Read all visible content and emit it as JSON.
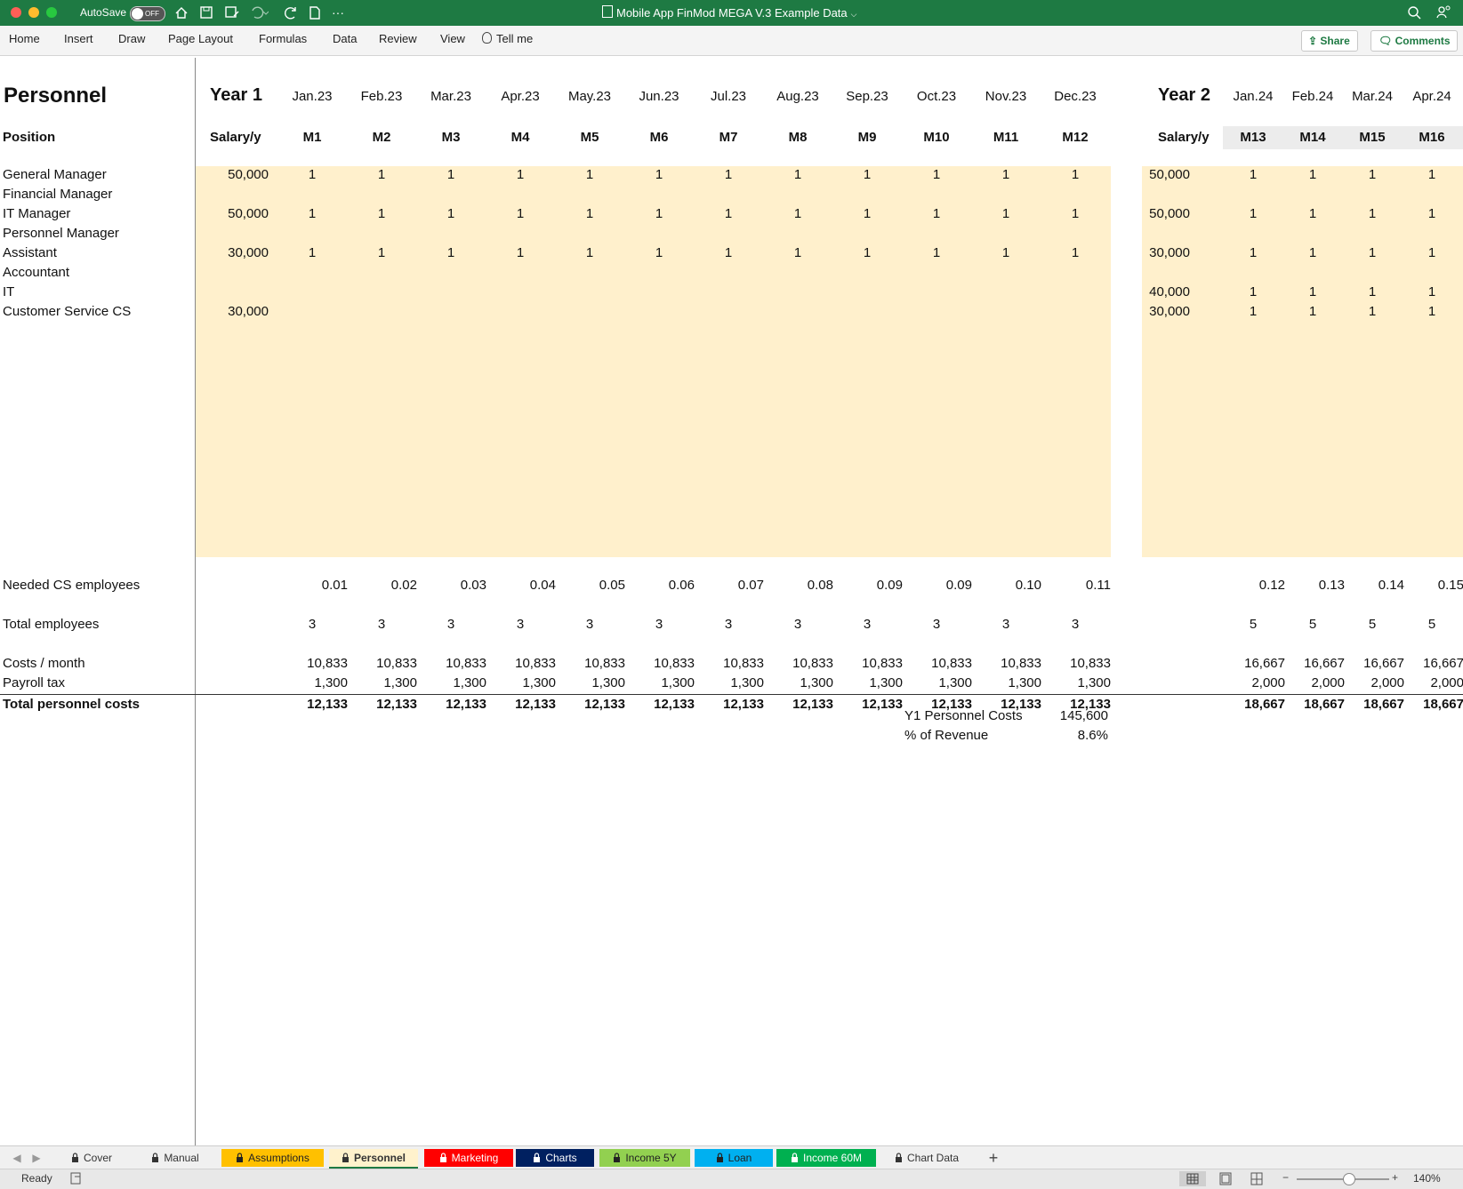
{
  "window": {
    "autosave_label": "AutoSave",
    "autosave_state": "OFF",
    "title": "Mobile App FinMod MEGA V.3 Example Data",
    "titlebar_color": "#1e7a43"
  },
  "ribbon": {
    "tabs": [
      "Home",
      "Insert",
      "Draw",
      "Page Layout",
      "Formulas",
      "Data",
      "Review",
      "View",
      "Tell me"
    ],
    "share_label": "Share",
    "comments_label": "Comments"
  },
  "sheet": {
    "title": "Personnel",
    "position_header": "Position",
    "year1": {
      "label": "Year 1",
      "salary_header": "Salary/y",
      "months": [
        "Jan.23",
        "Feb.23",
        "Mar.23",
        "Apr.23",
        "May.23",
        "Jun.23",
        "Jul.23",
        "Aug.23",
        "Sep.23",
        "Oct.23",
        "Nov.23",
        "Dec.23"
      ],
      "mcodes": [
        "M1",
        "M2",
        "M3",
        "M4",
        "M5",
        "M6",
        "M7",
        "M8",
        "M9",
        "M10",
        "M11",
        "M12"
      ]
    },
    "year2": {
      "label": "Year 2",
      "salary_header": "Salary/y",
      "months": [
        "Jan.24",
        "Feb.24",
        "Mar.24",
        "Apr.24"
      ],
      "mcodes": [
        "M13",
        "M14",
        "M15",
        "M16"
      ]
    },
    "positions": [
      {
        "name": "General Manager",
        "y1_salary": "50,000",
        "y1": [
          "1",
          "1",
          "1",
          "1",
          "1",
          "1",
          "1",
          "1",
          "1",
          "1",
          "1",
          "1"
        ],
        "y2_salary": "50,000",
        "y2": [
          "1",
          "1",
          "1",
          "1"
        ]
      },
      {
        "name": "Financial Manager",
        "y1_salary": "",
        "y1": [
          "",
          "",
          "",
          "",
          "",
          "",
          "",
          "",
          "",
          "",
          "",
          ""
        ],
        "y2_salary": "",
        "y2": [
          "",
          "",
          "",
          ""
        ]
      },
      {
        "name": "IT Manager",
        "y1_salary": "50,000",
        "y1": [
          "1",
          "1",
          "1",
          "1",
          "1",
          "1",
          "1",
          "1",
          "1",
          "1",
          "1",
          "1"
        ],
        "y2_salary": "50,000",
        "y2": [
          "1",
          "1",
          "1",
          "1"
        ]
      },
      {
        "name": "Personnel Manager",
        "y1_salary": "",
        "y1": [
          "",
          "",
          "",
          "",
          "",
          "",
          "",
          "",
          "",
          "",
          "",
          ""
        ],
        "y2_salary": "",
        "y2": [
          "",
          "",
          "",
          ""
        ]
      },
      {
        "name": "Assistant",
        "y1_salary": "30,000",
        "y1": [
          "1",
          "1",
          "1",
          "1",
          "1",
          "1",
          "1",
          "1",
          "1",
          "1",
          "1",
          "1"
        ],
        "y2_salary": "30,000",
        "y2": [
          "1",
          "1",
          "1",
          "1"
        ]
      },
      {
        "name": "Accountant",
        "y1_salary": "",
        "y1": [
          "",
          "",
          "",
          "",
          "",
          "",
          "",
          "",
          "",
          "",
          "",
          ""
        ],
        "y2_salary": "",
        "y2": [
          "",
          "",
          "",
          ""
        ]
      },
      {
        "name": "IT",
        "y1_salary": "",
        "y1": [
          "",
          "",
          "",
          "",
          "",
          "",
          "",
          "",
          "",
          "",
          "",
          ""
        ],
        "y2_salary": "40,000",
        "y2": [
          "1",
          "1",
          "1",
          "1"
        ]
      },
      {
        "name": "Customer Service CS",
        "y1_salary": "30,000",
        "y1": [
          "",
          "",
          "",
          "",
          "",
          "",
          "",
          "",
          "",
          "",
          "",
          ""
        ],
        "y2_salary": "30,000",
        "y2": [
          "1",
          "1",
          "1",
          "1"
        ]
      }
    ],
    "summary_rows": [
      {
        "label": "Needed CS employees",
        "y1": [
          "0.01",
          "0.02",
          "0.03",
          "0.04",
          "0.05",
          "0.06",
          "0.07",
          "0.08",
          "0.09",
          "0.09",
          "0.10",
          "0.11"
        ],
        "y2": [
          "0.12",
          "0.13",
          "0.14",
          "0.15"
        ]
      },
      {
        "label": "Total employees",
        "y1": [
          "3",
          "3",
          "3",
          "3",
          "3",
          "3",
          "3",
          "3",
          "3",
          "3",
          "3",
          "3"
        ],
        "y2": [
          "5",
          "5",
          "5",
          "5"
        ]
      },
      {
        "label": "Costs / month",
        "y1": [
          "10,833",
          "10,833",
          "10,833",
          "10,833",
          "10,833",
          "10,833",
          "10,833",
          "10,833",
          "10,833",
          "10,833",
          "10,833",
          "10,833"
        ],
        "y2": [
          "16,667",
          "16,667",
          "16,667",
          "16,667"
        ]
      },
      {
        "label": "Payroll tax",
        "y1": [
          "1,300",
          "1,300",
          "1,300",
          "1,300",
          "1,300",
          "1,300",
          "1,300",
          "1,300",
          "1,300",
          "1,300",
          "1,300",
          "1,300"
        ],
        "y2": [
          "2,000",
          "2,000",
          "2,000",
          "2,000"
        ]
      },
      {
        "label": "Total personnel costs",
        "y1": [
          "12,133",
          "12,133",
          "12,133",
          "12,133",
          "12,133",
          "12,133",
          "12,133",
          "12,133",
          "12,133",
          "12,133",
          "12,133",
          "12,133"
        ],
        "y2": [
          "18,667",
          "18,667",
          "18,667",
          "18,667"
        ]
      }
    ],
    "kpis": [
      {
        "label": "Y1 Personnel Costs",
        "value": "145,600"
      },
      {
        "label": "% of Revenue",
        "value": "8.6%"
      }
    ],
    "input_band_color": "#fff0cc"
  },
  "sheet_tabs": [
    {
      "label": "Cover",
      "bg": "#f0f0f0",
      "fg": "#333",
      "locked": true
    },
    {
      "label": "Manual",
      "bg": "#f0f0f0",
      "fg": "#333",
      "locked": true
    },
    {
      "label": "Assumptions",
      "bg": "#ffc000",
      "fg": "#222",
      "locked": true
    },
    {
      "label": "Personnel",
      "bg": "#fff2cc",
      "fg": "#333",
      "locked": true,
      "active": true
    },
    {
      "label": "Marketing",
      "bg": "#ff0000",
      "fg": "#fff",
      "locked": true
    },
    {
      "label": "Charts",
      "bg": "#002060",
      "fg": "#fff",
      "locked": true
    },
    {
      "label": "Income 5Y",
      "bg": "#92d050",
      "fg": "#222",
      "locked": true
    },
    {
      "label": "Loan",
      "bg": "#00b0f0",
      "fg": "#222",
      "locked": true
    },
    {
      "label": "Income 60M",
      "bg": "#00b050",
      "fg": "#fff",
      "locked": true
    },
    {
      "label": "Chart Data",
      "bg": "#f0f0f0",
      "fg": "#333",
      "locked": true
    }
  ],
  "status": {
    "ready": "Ready",
    "zoom": "140%"
  }
}
